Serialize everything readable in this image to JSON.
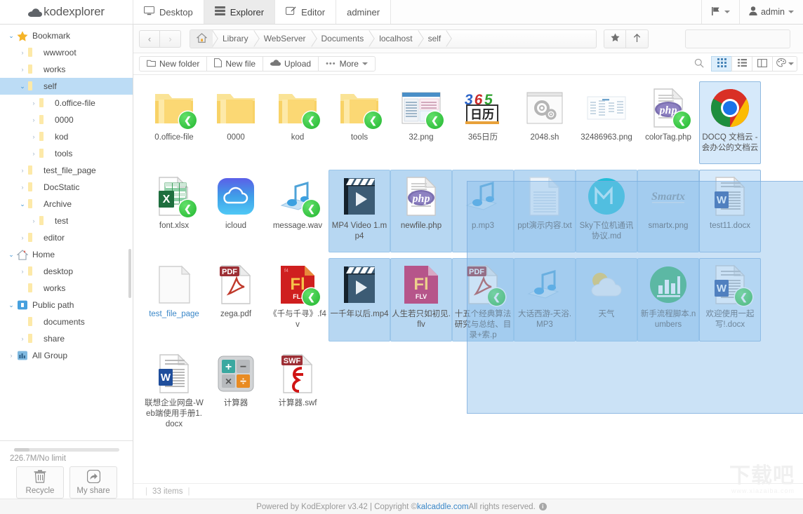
{
  "header": {
    "logo_text": "kodexplorer",
    "logo_icon": "cloud-icon",
    "tabs": [
      {
        "label": "Desktop",
        "icon": "monitor-icon",
        "active": false
      },
      {
        "label": "Explorer",
        "icon": "list-icon",
        "active": true
      },
      {
        "label": "Editor",
        "icon": "pencil-square-icon",
        "active": false
      },
      {
        "label": "adminer",
        "icon": "",
        "active": false
      }
    ],
    "flag_icon": "flag-icon",
    "user_label": "admin",
    "user_icon": "user-icon"
  },
  "sidebar": {
    "tree": [
      {
        "label": "Bookmark",
        "indent": 0,
        "twist": "open",
        "icon": "star-icon",
        "selected": false
      },
      {
        "label": "wwwroot",
        "indent": 1,
        "twist": "closed",
        "icon": "folder-icon",
        "selected": false
      },
      {
        "label": "works",
        "indent": 1,
        "twist": "closed",
        "icon": "folder-icon",
        "selected": false
      },
      {
        "label": "self",
        "indent": 1,
        "twist": "open",
        "icon": "folder-icon",
        "selected": true
      },
      {
        "label": "0.office-file",
        "indent": 2,
        "twist": "closed",
        "icon": "folder-icon",
        "selected": false
      },
      {
        "label": "0000",
        "indent": 2,
        "twist": "closed",
        "icon": "folder-icon",
        "selected": false
      },
      {
        "label": "kod",
        "indent": 2,
        "twist": "closed",
        "icon": "folder-icon",
        "selected": false
      },
      {
        "label": "tools",
        "indent": 2,
        "twist": "closed",
        "icon": "folder-icon",
        "selected": false
      },
      {
        "label": "test_file_page",
        "indent": 1,
        "twist": "closed",
        "icon": "folder-icon",
        "selected": false
      },
      {
        "label": "DocStatic",
        "indent": 1,
        "twist": "closed",
        "icon": "folder-icon",
        "selected": false
      },
      {
        "label": "Archive",
        "indent": 1,
        "twist": "open",
        "icon": "folder-icon",
        "selected": false
      },
      {
        "label": "test",
        "indent": 2,
        "twist": "closed",
        "icon": "folder-icon",
        "selected": false
      },
      {
        "label": "editor",
        "indent": 1,
        "twist": "closed",
        "icon": "folder-icon",
        "selected": false
      },
      {
        "label": "Home",
        "indent": 0,
        "twist": "open",
        "icon": "home-icon",
        "selected": false
      },
      {
        "label": "desktop",
        "indent": 1,
        "twist": "closed",
        "icon": "folder-icon",
        "selected": false
      },
      {
        "label": "works",
        "indent": 1,
        "twist": "none",
        "icon": "folder-icon",
        "selected": false
      },
      {
        "label": "Public path",
        "indent": 0,
        "twist": "open",
        "icon": "public-icon",
        "selected": false
      },
      {
        "label": "documents",
        "indent": 1,
        "twist": "none",
        "icon": "folder-icon",
        "selected": false
      },
      {
        "label": "share",
        "indent": 1,
        "twist": "closed",
        "icon": "folder-icon",
        "selected": false
      },
      {
        "label": "All Group",
        "indent": 0,
        "twist": "closed",
        "icon": "group-icon",
        "selected": false
      }
    ],
    "quota_text": "226.7M/No limit",
    "recycle_label": "Recycle",
    "recycle_icon": "trash-icon",
    "myshare_label": "My share",
    "myshare_icon": "share-arrow-icon"
  },
  "navbar": {
    "back_icon": "chevron-left-icon",
    "forward_icon": "chevron-right-icon",
    "home_icon": "home-icon",
    "breadcrumbs": [
      "Library",
      "WebServer",
      "Documents",
      "localhost",
      "self"
    ],
    "favorite_icon": "star-icon",
    "up_icon": "arrow-up-icon",
    "search_placeholder": "",
    "search_value": "",
    "search_icon": "search-icon"
  },
  "toolbar": {
    "buttons": [
      {
        "label": "New folder",
        "icon": "folder-outline-icon"
      },
      {
        "label": "New file",
        "icon": "file-outline-icon"
      },
      {
        "label": "Upload",
        "icon": "upload-cloud-icon"
      },
      {
        "label": "More",
        "icon": "ellipsis-icon",
        "caret": true
      }
    ],
    "view_search_icon": "search-icon",
    "views": [
      {
        "name": "grid-view",
        "icon": "grid-icon",
        "active": true
      },
      {
        "name": "list-view",
        "icon": "list-icon",
        "active": false
      },
      {
        "name": "split-view",
        "icon": "columns-icon",
        "active": false
      },
      {
        "name": "theme-view",
        "icon": "palette-icon",
        "active": false
      }
    ]
  },
  "files": [
    {
      "name": "0.office-file",
      "type": "folder",
      "shared": true,
      "selected": false,
      "focus": false
    },
    {
      "name": "0000",
      "type": "folder",
      "shared": false,
      "selected": false,
      "focus": false
    },
    {
      "name": "kod",
      "type": "folder",
      "shared": true,
      "selected": false,
      "focus": false
    },
    {
      "name": "tools",
      "type": "folder",
      "shared": true,
      "selected": false,
      "focus": false
    },
    {
      "name": "32.png",
      "type": "image-screenshot",
      "shared": true,
      "selected": false,
      "focus": false
    },
    {
      "name": "365日历",
      "type": "calendar-365",
      "shared": false,
      "selected": false,
      "focus": false
    },
    {
      "name": "2048.sh",
      "type": "script-gears",
      "shared": false,
      "selected": false,
      "focus": false
    },
    {
      "name": "32486963.png",
      "type": "image-faint",
      "shared": false,
      "selected": false,
      "focus": false
    },
    {
      "name": "colorTag.php",
      "type": "php",
      "shared": true,
      "selected": false,
      "focus": false
    },
    {
      "name": "DOCQ 文档云 - 会办公的文档云",
      "type": "chrome-link",
      "shared": false,
      "selected": false,
      "focus": true
    },
    {
      "name": "font.xlsx",
      "type": "excel",
      "shared": true,
      "selected": false,
      "focus": false
    },
    {
      "name": "icloud",
      "type": "icloud",
      "shared": false,
      "selected": false,
      "focus": false
    },
    {
      "name": "message.wav",
      "type": "audio",
      "shared": true,
      "selected": false,
      "focus": false
    },
    {
      "name": "MP4 Video 1.mp4",
      "type": "video",
      "shared": false,
      "selected": true,
      "focus": false
    },
    {
      "name": "newfile.php",
      "type": "php",
      "shared": false,
      "selected": true,
      "focus": false
    },
    {
      "name": "p.mp3",
      "type": "audio",
      "shared": false,
      "selected": true,
      "focus": false
    },
    {
      "name": "ppt演示内容.txt",
      "type": "text",
      "shared": false,
      "selected": true,
      "focus": false
    },
    {
      "name": "Sky下位机通讯协议.md",
      "type": "markdown",
      "shared": false,
      "selected": true,
      "focus": false
    },
    {
      "name": "smartx.png",
      "type": "image-smartx",
      "shared": false,
      "selected": true,
      "focus": false
    },
    {
      "name": "test11.docx",
      "type": "word",
      "shared": false,
      "selected": false,
      "focus": true
    },
    {
      "name": "test_file_page",
      "type": "blank-page",
      "shared": false,
      "selected": false,
      "focus": false,
      "link": true
    },
    {
      "name": "zega.pdf",
      "type": "pdf",
      "shared": false,
      "selected": false,
      "focus": false
    },
    {
      "name": "《千与千寻》.f4v",
      "type": "flash-f4v",
      "shared": true,
      "selected": false,
      "focus": false
    },
    {
      "name": "一千年以后.mp4",
      "type": "video",
      "shared": false,
      "selected": true,
      "focus": false
    },
    {
      "name": "人生若只如初见.flv",
      "type": "flv",
      "shared": false,
      "selected": true,
      "focus": false
    },
    {
      "name": "十五个经典算法研究与总结、目录+索.p",
      "type": "pdf",
      "shared": true,
      "selected": true,
      "focus": false
    },
    {
      "name": "大话西游-天浴.MP3",
      "type": "audio",
      "shared": false,
      "selected": true,
      "focus": false
    },
    {
      "name": "天气",
      "type": "weather",
      "shared": false,
      "selected": true,
      "focus": false
    },
    {
      "name": "新手流程脚本.numbers",
      "type": "numbers",
      "shared": false,
      "selected": true,
      "focus": false
    },
    {
      "name": "欢迎使用一起写!.docx",
      "type": "word",
      "shared": true,
      "selected": false,
      "focus": true
    },
    {
      "name": "联想企业网盘-Web端使用手册1.docx",
      "type": "word",
      "shared": false,
      "selected": false,
      "focus": false
    },
    {
      "name": "计算器",
      "type": "calculator",
      "shared": false,
      "selected": false,
      "focus": false
    },
    {
      "name": "计算器.swf",
      "type": "swf",
      "shared": false,
      "selected": false,
      "focus": false
    }
  ],
  "statusbar": {
    "items_text": "33 items"
  },
  "footer": {
    "powered": "Powered by KodExplorer v3.42 | Copyright © ",
    "link": "kalcaddle.com",
    "rights": " All rights reserved.",
    "info_icon": "info-icon"
  },
  "watermark": {
    "line1": "下载吧",
    "line2": "www.xiazaiba.com"
  },
  "colors": {
    "accent": "#3a87c8",
    "selection": "#b7d7f2",
    "folder": "#fbd874",
    "share_badge": "#22b62f"
  }
}
